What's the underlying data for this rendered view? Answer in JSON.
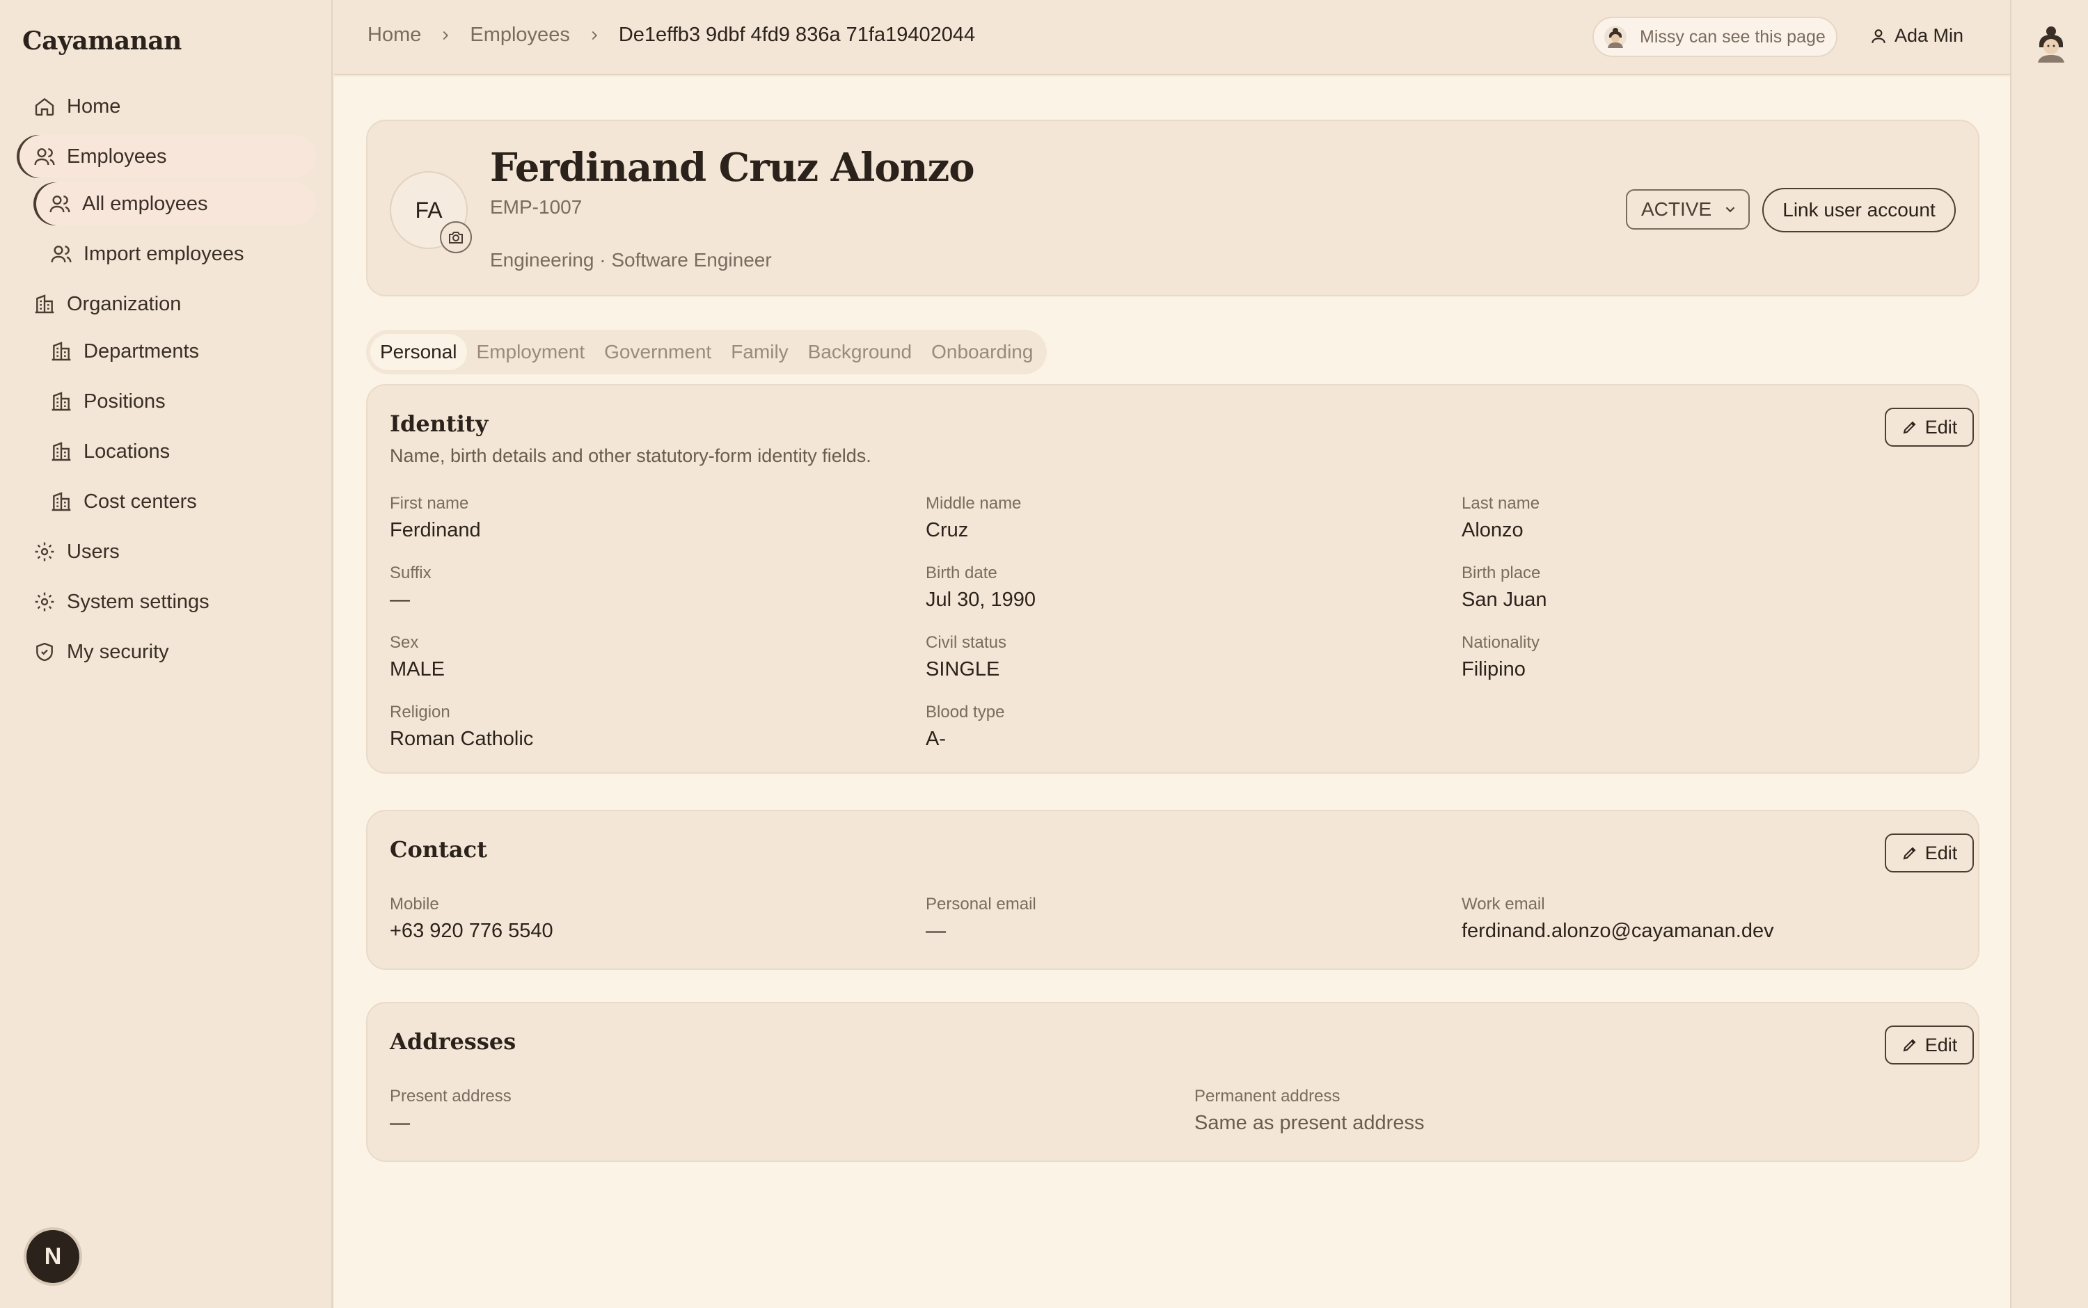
{
  "brand": "Cayamanan",
  "sidebar": {
    "items": [
      {
        "label": "Home"
      },
      {
        "label": "Employees"
      },
      {
        "label": "All employees"
      },
      {
        "label": "Import employees"
      },
      {
        "label": "Organization"
      },
      {
        "label": "Departments"
      },
      {
        "label": "Positions"
      },
      {
        "label": "Locations"
      },
      {
        "label": "Cost centers"
      },
      {
        "label": "Users"
      },
      {
        "label": "System settings"
      },
      {
        "label": "My security"
      }
    ],
    "badge": "N"
  },
  "topbar": {
    "breadcrumb": [
      "Home",
      "Employees",
      "De1effb3 9dbf 4fd9 836a 71fa19402044"
    ],
    "visibility": "Missy can see this page",
    "user": "Ada Min"
  },
  "employee": {
    "initials": "FA",
    "name": "Ferdinand Cruz Alonzo",
    "code": "EMP-1007",
    "role": "Engineering · Software Engineer",
    "status": "ACTIVE",
    "link_label": "Link user account"
  },
  "tabs": [
    "Personal",
    "Employment",
    "Government",
    "Family",
    "Background",
    "Onboarding"
  ],
  "identity": {
    "title": "Identity",
    "description": "Name, birth details and other statutory-form identity fields.",
    "edit": "Edit",
    "fields": [
      {
        "label": "First name",
        "value": "Ferdinand"
      },
      {
        "label": "Middle name",
        "value": "Cruz"
      },
      {
        "label": "Last name",
        "value": "Alonzo"
      },
      {
        "label": "Suffix",
        "value": "—"
      },
      {
        "label": "Birth date",
        "value": "Jul 30, 1990"
      },
      {
        "label": "Birth place",
        "value": "San Juan"
      },
      {
        "label": "Sex",
        "value": "MALE"
      },
      {
        "label": "Civil status",
        "value": "SINGLE"
      },
      {
        "label": "Nationality",
        "value": "Filipino"
      },
      {
        "label": "Religion",
        "value": "Roman Catholic"
      },
      {
        "label": "Blood type",
        "value": "A-"
      }
    ]
  },
  "contact": {
    "title": "Contact",
    "edit": "Edit",
    "fields": [
      {
        "label": "Mobile",
        "value": "+63 920 776 5540"
      },
      {
        "label": "Personal email",
        "value": "—"
      },
      {
        "label": "Work email",
        "value": "ferdinand.alonzo@cayamanan.dev"
      }
    ]
  },
  "addresses": {
    "title": "Addresses",
    "edit": "Edit",
    "fields": [
      {
        "label": "Present address",
        "value": "—"
      },
      {
        "label": "Permanent address",
        "value": "Same as present address"
      }
    ]
  }
}
